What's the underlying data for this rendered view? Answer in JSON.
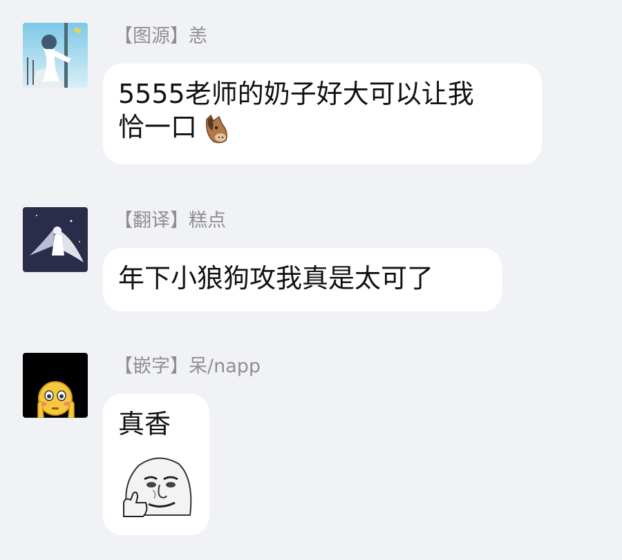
{
  "messages": [
    {
      "sender": "【图源】恙",
      "text_line1": "5555老师的奶子好大可以让我",
      "text_line2": "恰一口",
      "emoji": "horse-face-icon",
      "avatar": "anime-girl-avatar"
    },
    {
      "sender": "【翻译】糕点",
      "text_line1": "年下小狼狗攻我真是太可了",
      "avatar": "angel-moon-avatar"
    },
    {
      "sender": "【嵌字】呆/napp",
      "text_line1": "真香",
      "sticker": "thumbs-up-meme-face",
      "avatar": "flushed-emoji-avatar"
    }
  ]
}
